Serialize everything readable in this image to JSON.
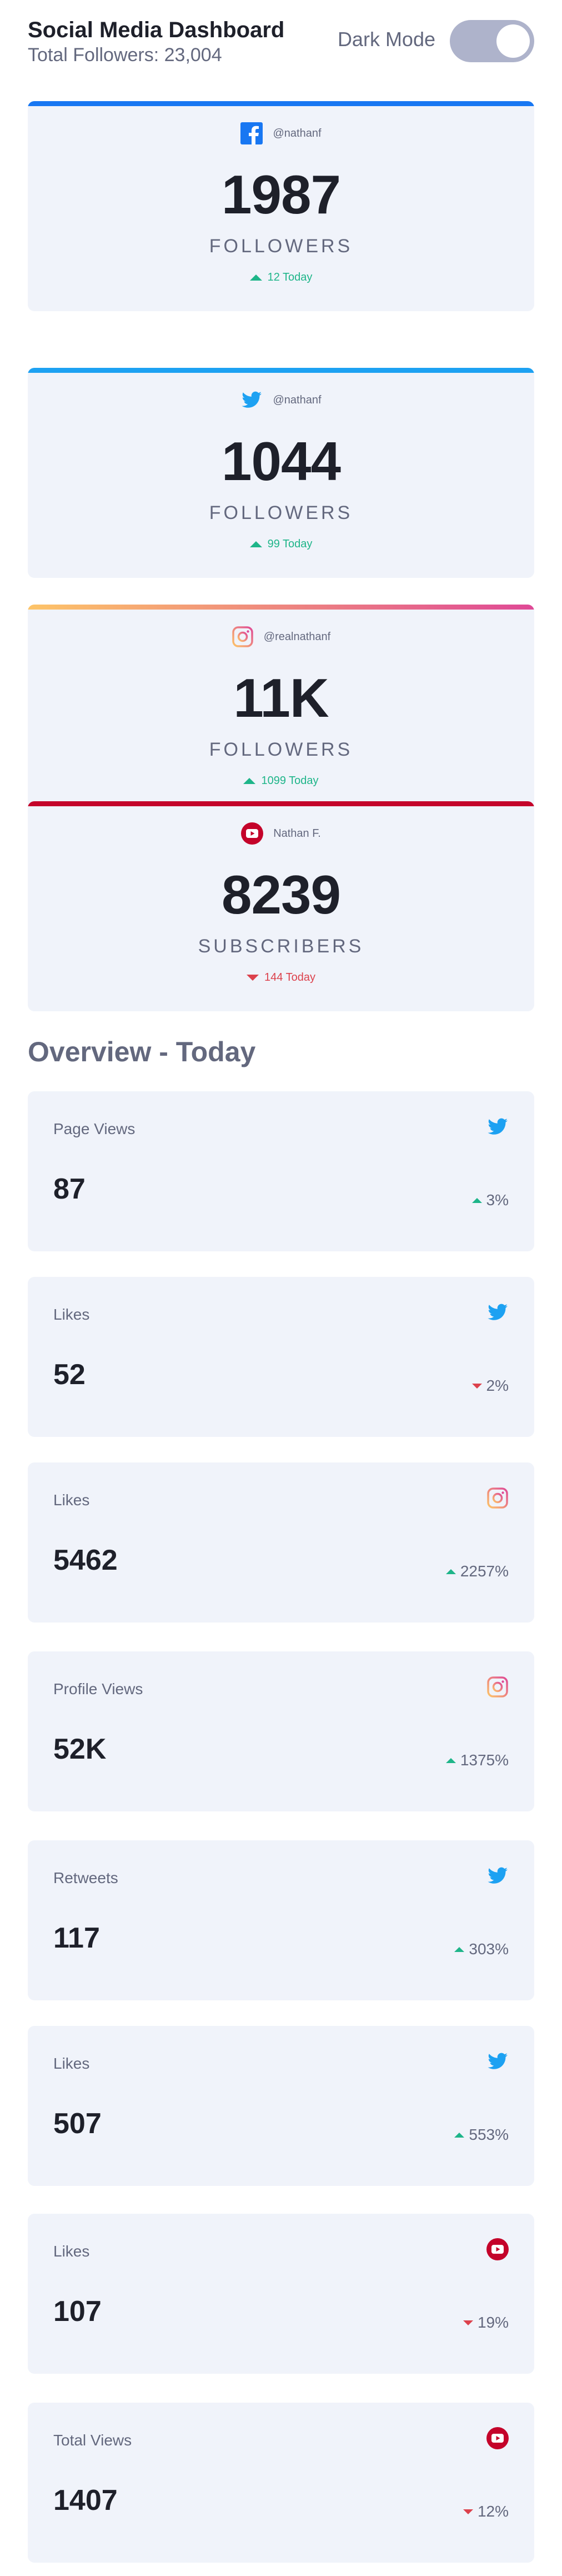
{
  "header": {
    "title": "Social Media Dashboard",
    "total_followers": "Total Followers: 23,004",
    "dark_mode_label": "Dark Mode"
  },
  "colors": {
    "facebook": "#1877f2",
    "twitter": "#1da1f2",
    "instagram_start": "#fdc468",
    "instagram_end": "#df4996",
    "youtube": "#c4032a",
    "up": "#1eb589",
    "down": "#dc414c"
  },
  "cards": [
    {
      "platform": "facebook",
      "icon": "facebook-icon",
      "handle": "@nathanf",
      "count": "1987",
      "unit": "FOLLOWERS",
      "today": "12 Today",
      "trend": "up"
    },
    {
      "platform": "twitter",
      "icon": "twitter-icon",
      "handle": "@nathanf",
      "count": "1044",
      "unit": "FOLLOWERS",
      "today": "99 Today",
      "trend": "up"
    },
    {
      "platform": "instagram",
      "icon": "instagram-icon",
      "handle": "@realnathanf",
      "count": "11K",
      "unit": "FOLLOWERS",
      "today": "1099 Today",
      "trend": "up"
    },
    {
      "platform": "youtube",
      "icon": "youtube-icon",
      "handle": "Nathan F.",
      "count": "8239",
      "unit": "SUBSCRIBERS",
      "today": "144 Today",
      "trend": "down"
    }
  ],
  "overview": {
    "title": "Overview - Today",
    "items": [
      {
        "label": "Page Views",
        "icon": "twitter-icon",
        "value": "87",
        "change": "3%",
        "trend": "up"
      },
      {
        "label": "Likes",
        "icon": "twitter-icon",
        "value": "52",
        "change": "2%",
        "trend": "down"
      },
      {
        "label": "Likes",
        "icon": "instagram-icon",
        "value": "5462",
        "change": "2257%",
        "trend": "up"
      },
      {
        "label": "Profile Views",
        "icon": "instagram-icon",
        "value": "52K",
        "change": "1375%",
        "trend": "up"
      },
      {
        "label": "Retweets",
        "icon": "twitter-icon",
        "value": "117",
        "change": "303%",
        "trend": "up"
      },
      {
        "label": "Likes",
        "icon": "twitter-icon",
        "value": "507",
        "change": "553%",
        "trend": "up"
      },
      {
        "label": "Likes",
        "icon": "youtube-icon",
        "value": "107",
        "change": "19%",
        "trend": "down"
      },
      {
        "label": "Total Views",
        "icon": "youtube-icon",
        "value": "1407",
        "change": "12%",
        "trend": "down"
      }
    ]
  }
}
